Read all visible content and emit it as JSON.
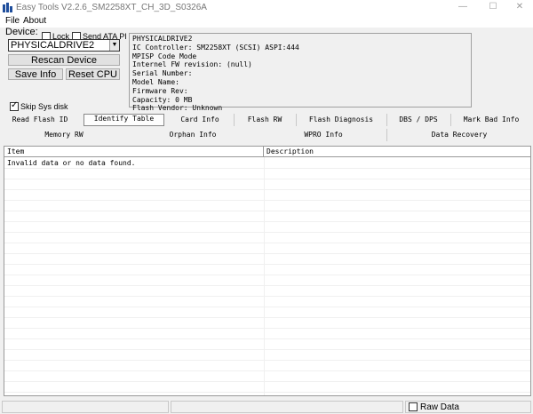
{
  "window": {
    "title": "Easy Tools V2.2.6_SM2258XT_CH_3D_S0326A",
    "min_glyph": "—",
    "max_glyph": "☐",
    "close_glyph": "✕"
  },
  "menu": {
    "items": [
      "File",
      "About"
    ]
  },
  "device": {
    "label": "Device:",
    "lock_label": "Lock",
    "send_ata_label": "Send ATA PI",
    "selected": "PHYSICALDRIVE2",
    "rescan_label": "Rescan Device",
    "save_info_label": "Save Info",
    "reset_cpu_label": "Reset CPU",
    "skip_sys_label": "Skip Sys disk",
    "skip_sys_checked": true
  },
  "info_lines": [
    "PHYSICALDRIVE2",
    "IC Controller: SM2258XT (SCSI) ASPI:444",
    "MPISP Code Mode",
    "Internel FW revision: (null)",
    "Serial Number:",
    "Model Name:",
    "Firmware Rev:",
    "Capacity: 0 MB",
    "Flash Vendor: Unknown"
  ],
  "tabs_row1": [
    "Read Flash ID",
    "Identify Table",
    "Card Info",
    "Flash RW",
    "Flash Diagnosis",
    "DBS / DPS",
    "Mark Bad Info"
  ],
  "tabs_row2": [
    "Memory RW",
    "Orphan Info",
    "WPRO Info",
    "Data Recovery"
  ],
  "active_tab": "Identify Table",
  "table": {
    "columns": [
      "Item",
      "Description"
    ],
    "rows": [
      [
        "Invalid data or no data found.",
        ""
      ]
    ]
  },
  "status": {
    "raw_data_label": "Raw Data",
    "raw_data_checked": false
  },
  "colors": {
    "window_bg": "#f0f0f0",
    "icon_blue": "#1f4e9c"
  }
}
